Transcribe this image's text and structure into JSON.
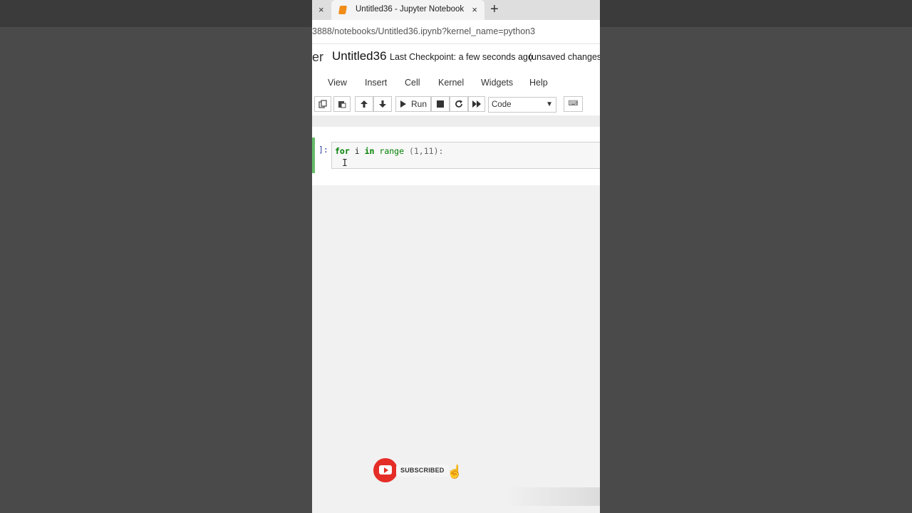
{
  "browser": {
    "tab_title": "Untitled36 - Jupyter Notebook",
    "close_glyph": "×",
    "new_tab_glyph": "+",
    "url": "3888/notebooks/Untitled36.ipynb?kernel_name=python3"
  },
  "jupyter": {
    "logo_fragment": "er",
    "notebook_name": "Untitled36",
    "checkpoint": "Last Checkpoint: a few seconds ago",
    "unsaved": "(unsaved changes)",
    "menu": [
      "View",
      "Insert",
      "Cell",
      "Kernel",
      "Widgets",
      "Help"
    ],
    "run_label": "Run",
    "cell_type": "Code",
    "cell_prompt": "]:",
    "code": {
      "kw_for": "for",
      "var": "i",
      "kw_in": "in",
      "builtin": "range",
      "args": "(1,11):"
    }
  },
  "overlay": {
    "subscribe_label": "SUBSCRIBED",
    "accent_color": "#e52d27"
  }
}
